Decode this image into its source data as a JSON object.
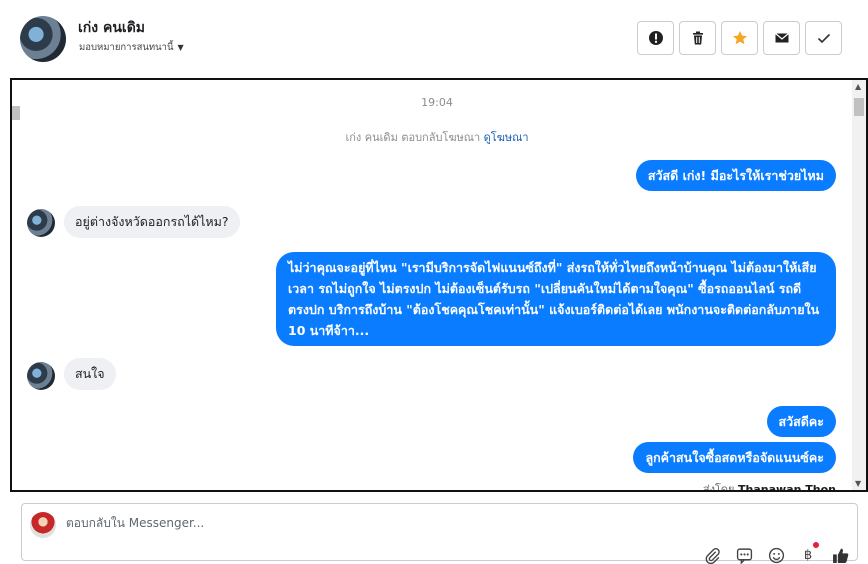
{
  "header": {
    "contact_name": "เก่ง คนเดิม",
    "assign_label": "มอบหมายการสนทนานี้",
    "actions": {
      "spam": "alert-icon",
      "delete": "trash-icon",
      "star": "star-icon",
      "unread": "mail-icon",
      "done": "check-icon"
    },
    "star_color": "#f5a623"
  },
  "conversation": {
    "timestamp": "19:04",
    "reply_note_prefix": "เก่ง คนเดิม ตอบกลับโฆษณา",
    "reply_note_link": "ดูโฆษณา",
    "messages": [
      {
        "dir": "out",
        "text": "สวัสดี เก่ง! มีอะไรให้เราช่วยไหม"
      },
      {
        "dir": "in",
        "text": "อยู่ต่างจังหวัดออกรถได้ไหม?"
      },
      {
        "dir": "out",
        "text": "ไม่ว่าคุณจะอยู่ที่ไหน \"เรามีบริการจัดไฟแนนซ์ถึงที่\"  ส่งรถให้ทั่วไทยถึงหน้าบ้านคุณ ไม่ต้องมาให้เสียเวลา รถไม่ถูกใจ ไม่ตรงปก ไม่ต้องเซ็นต์รับรถ \"เปลี่ยนคันใหม่ได้ตามใจคุณ\" ซื้อรถออนไลน์ รถดี ตรงปก บริการถึงบ้าน \"ต้องโชคคุณโชคเท่านั้น\" แจ้งเบอร์ติดต่อได้เลย พนักงานจะติดต่อกลับภายใน 10 นาทีจ้าา..."
      },
      {
        "dir": "in",
        "text": "สนใจ"
      },
      {
        "dir": "out",
        "text": "สวัสดีคะ"
      },
      {
        "dir": "out",
        "text": "ลูกค้าสนใจซื้อสดหรือจัดแนนซ์คะ"
      }
    ],
    "sent_by_prefix": "ส่งโดย",
    "sent_by_name": "Thanawan Thon",
    "bubble_color": "#0a7cff"
  },
  "composer": {
    "placeholder": "ตอบกลับใน Messenger...",
    "tools": [
      "attachment-icon",
      "saved-reply-icon",
      "emoji-icon",
      "payment-icon",
      "like-icon"
    ]
  }
}
